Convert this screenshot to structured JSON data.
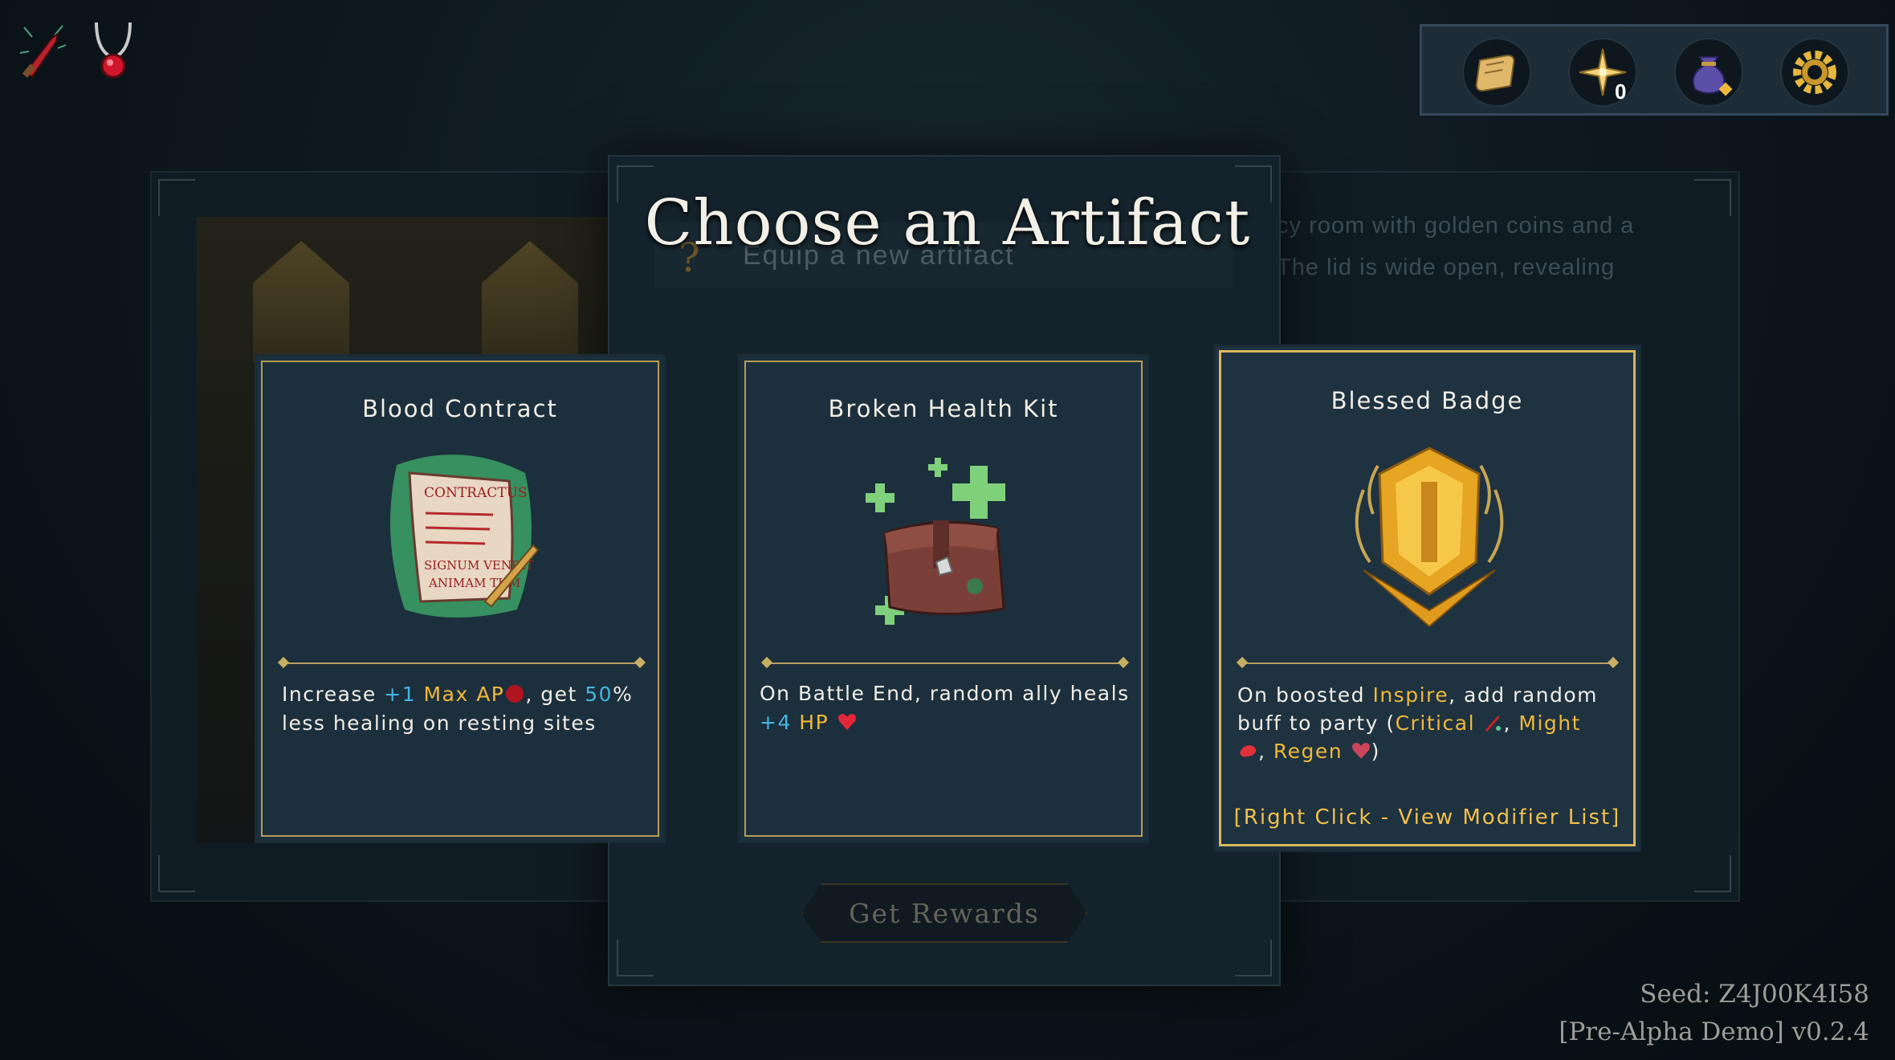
{
  "screen": {
    "title": "Choose an Artifact",
    "subtitle": "Equip a new artifact",
    "background_text_line1": "cy room with golden coins and a",
    "background_text_line2": "The lid is wide open, revealing"
  },
  "equipped_items": [
    {
      "icon": "bloodied-dagger-icon"
    },
    {
      "icon": "ruby-amulet-icon"
    }
  ],
  "toolbar": {
    "buttons": [
      {
        "icon": "scroll-map-icon"
      },
      {
        "icon": "compass-star-icon",
        "count": "0"
      },
      {
        "icon": "loot-bag-icon"
      },
      {
        "icon": "gear-settings-icon"
      }
    ]
  },
  "cards": [
    {
      "title": "Blood Contract",
      "art": "blood-contract-scroll",
      "desc_parts": [
        "Increase ",
        "+1",
        " Max AP",
        ", get ",
        "50",
        "%",
        "less healing on resting sites"
      ]
    },
    {
      "title": "Broken Health Kit",
      "art": "broken-health-kit",
      "desc_parts": [
        "On Battle End, random ally heals",
        "+4",
        " HP"
      ]
    },
    {
      "title": "Blessed Badge",
      "art": "blessed-badge",
      "desc_parts": [
        "On boosted ",
        "Inspire",
        ", add random",
        "buff to party (",
        "Critical",
        ", ",
        "Might",
        ", ",
        "Regen",
        ")"
      ],
      "modifier_link": "[Right Click - View Modifier List]"
    }
  ],
  "reward_button": {
    "label": "Get Rewards"
  },
  "footer": {
    "seed": "Seed: Z4J00K4I58",
    "version": "[Pre-Alpha Demo] v0.2.4"
  },
  "colors": {
    "accent_gold": "#f0b83a",
    "highlight_blue": "#43b6e2",
    "card_bg": "#1c2f3c",
    "card_border": "#b69c55"
  }
}
